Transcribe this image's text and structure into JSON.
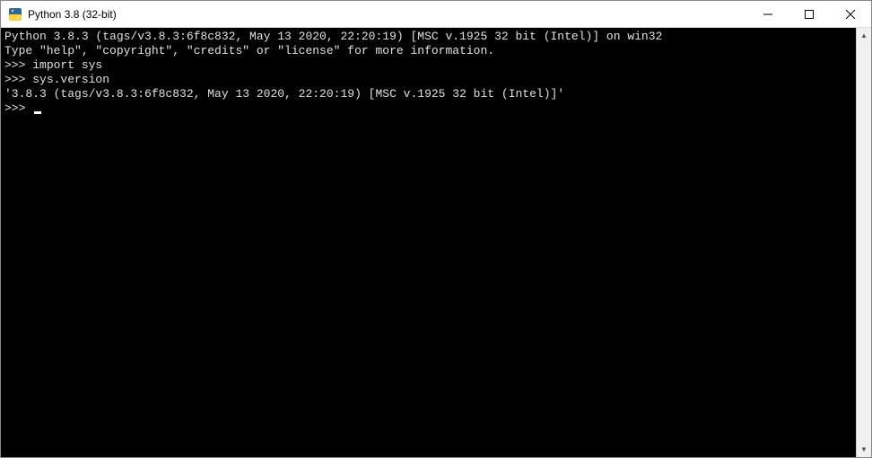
{
  "titlebar": {
    "title": "Python 3.8 (32-bit)"
  },
  "console": {
    "banner_line1": "Python 3.8.3 (tags/v3.8.3:6f8c832, May 13 2020, 22:20:19) [MSC v.1925 32 bit (Intel)] on win32",
    "banner_line2": "Type \"help\", \"copyright\", \"credits\" or \"license\" for more information.",
    "prompt": ">>> ",
    "lines": [
      {
        "prompt": ">>> ",
        "input": "import sys"
      },
      {
        "prompt": ">>> ",
        "input": "sys.version"
      }
    ],
    "output1": "'3.8.3 (tags/v3.8.3:6f8c832, May 13 2020, 22:20:19) [MSC v.1925 32 bit (Intel)]'"
  }
}
